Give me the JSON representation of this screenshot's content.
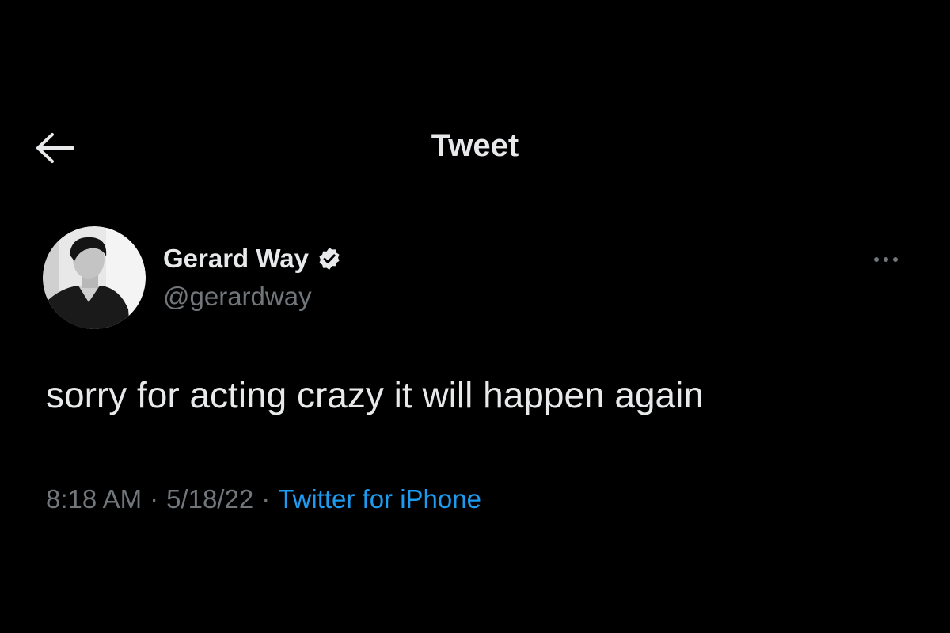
{
  "header": {
    "title": "Tweet",
    "back_icon": "arrow-left-icon"
  },
  "author": {
    "display_name": "Gerard Way",
    "handle": "@gerardway",
    "verified": true,
    "verified_icon": "verified-badge-icon",
    "avatar": "profile-photo"
  },
  "tweet": {
    "text": "sorry for acting crazy it will happen again",
    "time": "8:18 AM",
    "separator": "·",
    "date": "5/18/22",
    "source": "Twitter for iPhone"
  },
  "more_icon": "more-horizontal-icon",
  "colors": {
    "background": "#000000",
    "primary_text": "#e7e9ea",
    "secondary_text": "#71767b",
    "link": "#1d9bf0",
    "divider": "#3a3d41"
  }
}
